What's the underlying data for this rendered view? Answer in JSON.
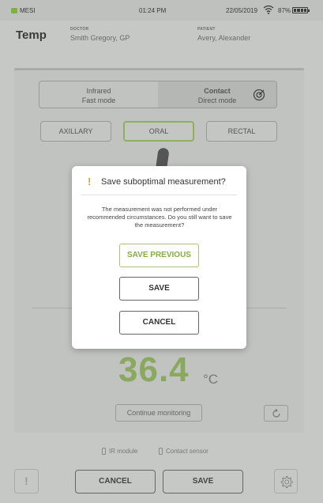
{
  "status_bar": {
    "carrier": "MESI",
    "time": "01:24 PM",
    "date": "22/05/2019",
    "battery": "87%"
  },
  "header": {
    "title": "Temp",
    "doctor_label": "DOCTOR",
    "doctor_name": "Smith Gregory, GP",
    "patient_label": "PATIENT",
    "patient_name": "Avery, Alexander"
  },
  "mode_toggle": {
    "infrared_title": "Infrared",
    "infrared_sub": "Fast mode",
    "contact_title": "Contact",
    "contact_sub": "Direct mode",
    "selected": "Contact"
  },
  "sites": {
    "axillary": "AXILLARY",
    "oral": "ORAL",
    "rectal": "RECTAL",
    "selected": "ORAL"
  },
  "measurement": {
    "value": "36.4",
    "unit": "°C",
    "continue_label": "Continue monitoring"
  },
  "modules": {
    "ir": "IR module",
    "contact": "Contact sensor"
  },
  "bottom_bar": {
    "warn_glyph": "!",
    "cancel_label": "CANCEL",
    "save_label": "SAVE"
  },
  "dialog": {
    "warn_glyph": "!",
    "title": "Save suboptimal measurement?",
    "message": "The measurement was not performed under recommended circumstances. Do you still want to save the measurement?",
    "save_previous_label": "SAVE PREVIOUS",
    "save_label": "SAVE",
    "cancel_label": "CANCEL"
  },
  "colors": {
    "accent_green": "#84ac44",
    "warning_orange": "#e3a13a",
    "overlay_gray": "#c6c8c6"
  }
}
